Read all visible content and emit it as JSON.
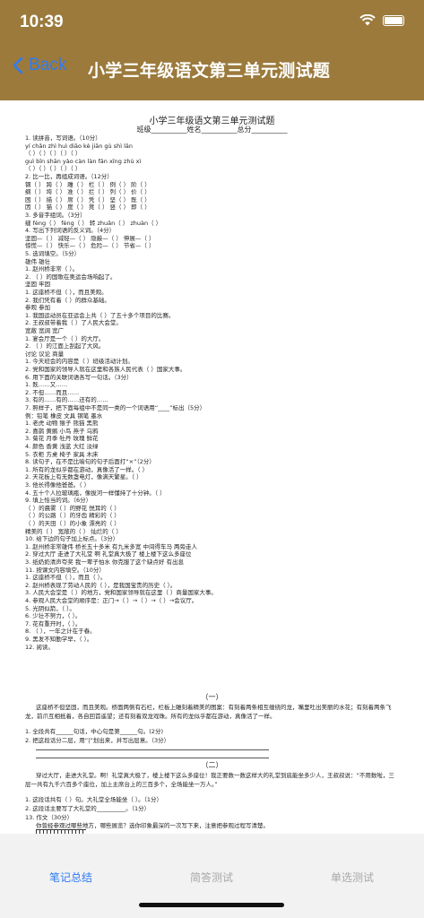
{
  "status": {
    "time": "10:39"
  },
  "nav": {
    "back_label": "Back",
    "title": "小学三年级语文第三单元测试题"
  },
  "doc": {
    "title": "小学三年级语文第三单元测试题",
    "info": "班级__________姓名__________总分__________",
    "lines": [
      "1. 读拼音，写词语。（10分）",
      "    yí chǎn    zhì huì    diāo kè    jiān gù    shì lān",
      "  （   ）（   ）（   ）（   ）（   ）",
      "    guì bīn    shān yào    càn làn    fān xīng    zhù xì",
      "  （   ）（   ）（   ）（   ）（   ）",
      "2. 比一比，再组成词语。（12分）",
      "  钢（   ）  跨（   ）  雕（   ）  栏（   ）  例（   ）  阶（   ）",
      "  纲（   ）  垮（   ）  准（   ）  拦（   ）  列（   ）  价（   ）",
      "  困（   ）  描（   ）  席（   ）  凭（   ）  坚（   ）  既（   ）",
      "  因（   ）  猫（   ）  度（   ）  凳（   ）  竖（   ）  即（   ）",
      "3. 多音字组词。（3分）",
      "  缝 fèng（   ）  fèng（   ）  转 zhuǎn（   ）  zhuàn（   ）",
      "4. 写出下列词语的反义词。（4分）",
      "  坚固—（   ）  减轻—（   ）  隐蔽—（   ）  伸展—（   ）",
      "  惊慌—（   ）  快乐—（   ）  危险—（   ）  节省—（   ）",
      "5. 选词填空。（5分）",
      "                                                      雄伟     雄壮",
      "  1. 赵州桥非常（   ）。",
      "  2. （   ）的国歌在奥运会场响起了。",
      "                                                      坚固     牢固",
      "  1. 这座桥不但（   ），而且美观。",
      "  2. 我们凭有着（   ）的群众基础。",
      "                                                      参观     参加",
      "  1. 我国运动员在亚运会上共（   ）了五十多个项目的比赛。",
      "  2. 王叔叔带着我（   ）了人民大会堂。",
      "                                                  宽敞     宽阔     宽广",
      "  1. 宴会厅是一个（   ）的大厅。",
      "  2. （   ）的江面上刮起了大风。",
      "                                              讨论     议论     商量",
      "  1. 今天班会的内容是（   ）班级活动计划。",
      "  2. 党和国家的领导人就在这里和各族人民代表（   ）国家大事。",
      "6. 用下面的关联词语各写一句话。（3分）",
      "  1. 既……又……",
      "  2. 不但……而且……",
      "  3. 有的……有的……还有的……",
      "7. 照样子，把下面每组中不是同一类的一个词语用“____”标出（5分）",
      "  例：铅笔 橡皮  文具  钢笔  墨水",
      "  1. 老虎 动物  猴子  熊猫  黑熊",
      "  2. 喜鹊 黄鹂  小鸟  燕子  乌鸦",
      "  3. 菊花 月季  牡丹  玫瑰  鲜花",
      "  4. 颜色 香黄  浅蓝  大红  淡绿",
      "  5. 衣柜 方桌  椅子  家具  木床",
      "8. 读句子，在不是比喻句的句子后面打“×”（2分）",
      "  1. 所有的龙似乎都在游动，真像活了一样。（   ）",
      "  2. 天花板上有无数盏电灯，像满天繁星。（   ）",
      "  3. 他长得像他爸爸。（   ）",
      "  4. 五十个人拉玻璃瓶，像拔河一样懂持了十分钟。（   ）",
      "9. 填上恰当的词。（6分）",
      "  （   ）的晨雾（   ）的野花 悦耳的（   ）",
      "  （   ）的公路（   ）的牙齿 精彩的（   ）",
      "  （   ）的天田（   ）的小象 漂亮的（   ）",
      "  精美的（   ）  宽敞的（   ）  灿烂的（   ）",
      "10. 给下边的句子加上标点。（3分）",
      "  1. 赵州桥非常雄伟  桥长五十多米  有九米多宽  中间得车马  两旁走人",
      "  2. 穿过大厅  走进了大礼堂  啊  礼堂真大极了  楼上楼下这么多座位",
      "  3. 纸奶奶清声夸奖  我一辈子怕水  你克服了这个缺点好  有出息",
      "11. 按课文内容填空。（10分）",
      "  1. 这座桥不但（   ），而且（   ）。",
      "  2. 赵州桥表现了劳动人民的（   ），是我国宝贵的历史（   ）。",
      "  3. 人民大会堂是（   ）的地方，党和国家领导就在这里（   ）商量国家大事。",
      "  4. 参观人民大会堂的顺序是：正门→（   ）→（   ）→（   ）→会议厅。",
      "  5. 光阴似箭，（   ）。",
      "  6. 少壮不努力，（   ）。",
      "  7. 花有重开时，（   ）。",
      "  8. （                    ），一年之计在于春。",
      "  9. 黑发不知勤学早，（   ）。",
      "12. 阅读。"
    ],
    "section_one": "（一）",
    "passage_one": "这座桥不但坚固，而且美观。桥面两侧有石栏，栏板上雕刻着精美的图案：有刻着两条相互缠绕的龙，嘴里吐出美丽的水花；有刻着两条飞龙，前爪互相抵着，各自回首遥望；还有刻着双龙戏珠。所有的龙似乎都在游动，真像活了一样。",
    "questions_one": [
      "  1. 全段共有______句话，中心句是第______句。(2分)",
      "  2. 把这段话分二层，用“|”划出来，并写出层意。（3分）"
    ],
    "section_two": "（二）",
    "passage_two": "穿过大厅，走进大礼堂。啊！礼堂真大极了，楼上楼下这么多座位！我正要数一数这样大的礼堂到底能坐多少人，王叔叔说：“不用数啦，三层一共有九千六百多个座位，加上主席台上的三百多个，全场能坐一万人。”",
    "questions_two": [
      "  1. 这段话共有（   ）句。大礼堂全场能坐（   ）。（1分）",
      "  2. 这段话主要写了大礼堂的__________。（1分）"
    ],
    "essay_title": "13. 作文（30分）",
    "essay_prompt": "你曾经参观过哪些地方，哪些展览？选你印象最深的一次写下来，注意把参观过程写清楚。"
  },
  "tabs": [
    {
      "label": "笔记总结",
      "active": true
    },
    {
      "label": "简答测试",
      "active": false
    },
    {
      "label": "单选测试",
      "active": false
    }
  ],
  "colors": {
    "header": "#9b7a3c",
    "accent": "#2f7bf5",
    "tabbar": "#f2f2f2",
    "inactive": "#a8a8a8"
  }
}
